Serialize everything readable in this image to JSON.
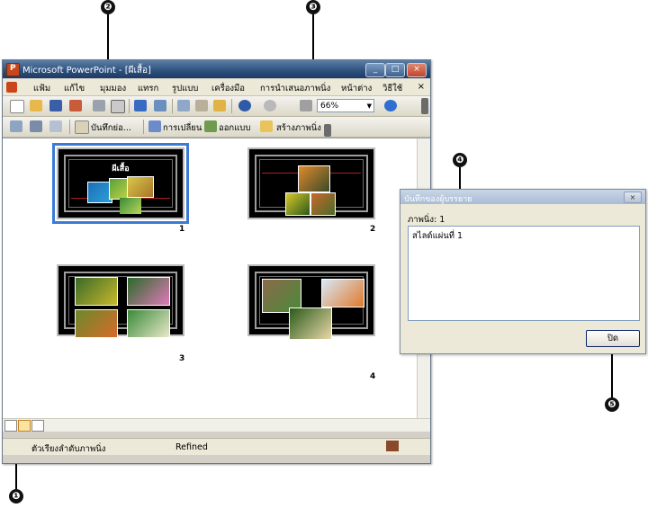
{
  "window": {
    "title": "Microsoft PowerPoint - [ผีเสื้อ]",
    "controls": [
      "_",
      "□",
      "×"
    ]
  },
  "menu": {
    "items": [
      "แฟ้ม",
      "แก้ไข",
      "มุมมอง",
      "แทรก",
      "รูปแบบ",
      "เครื่องมือ",
      "การนำเสนอภาพนิ่ง",
      "หน้าต่าง",
      "วิธีใช้"
    ],
    "close": "×"
  },
  "toolbar": {
    "zoom_value": "66%"
  },
  "slide_sorter_toolbar": {
    "notes_label": "บันทึกย่อ...",
    "transition_label": "การเปลี่ยน",
    "design_label": "ออกแบบ",
    "new_slide_label": "สร้างภาพนิ่ง"
  },
  "slides": [
    {
      "number": "1",
      "title": "ผีเสื้อ",
      "selected": true
    },
    {
      "number": "2",
      "title": "",
      "selected": false
    },
    {
      "number": "3",
      "title": "",
      "selected": false
    },
    {
      "number": "4",
      "title": "",
      "selected": false
    }
  ],
  "statusbar": {
    "view": "ตัวเรียงลำดับภาพนิ่ง",
    "design": "Refined"
  },
  "notes_dialog": {
    "title": "บันทึกของผู้บรรยาย",
    "slide_label": "ภาพนิ่ง: 1",
    "notes_text": "สไลด์แผ่นที่ 1",
    "close_button": "ปิด",
    "close_x": "×"
  },
  "callouts": [
    "❶",
    "❷",
    "❸",
    "❹",
    "❺"
  ],
  "colors": {
    "titlebar": "#2d4f7c",
    "selection": "#3d7ad6",
    "slide_bg": "#000000"
  }
}
